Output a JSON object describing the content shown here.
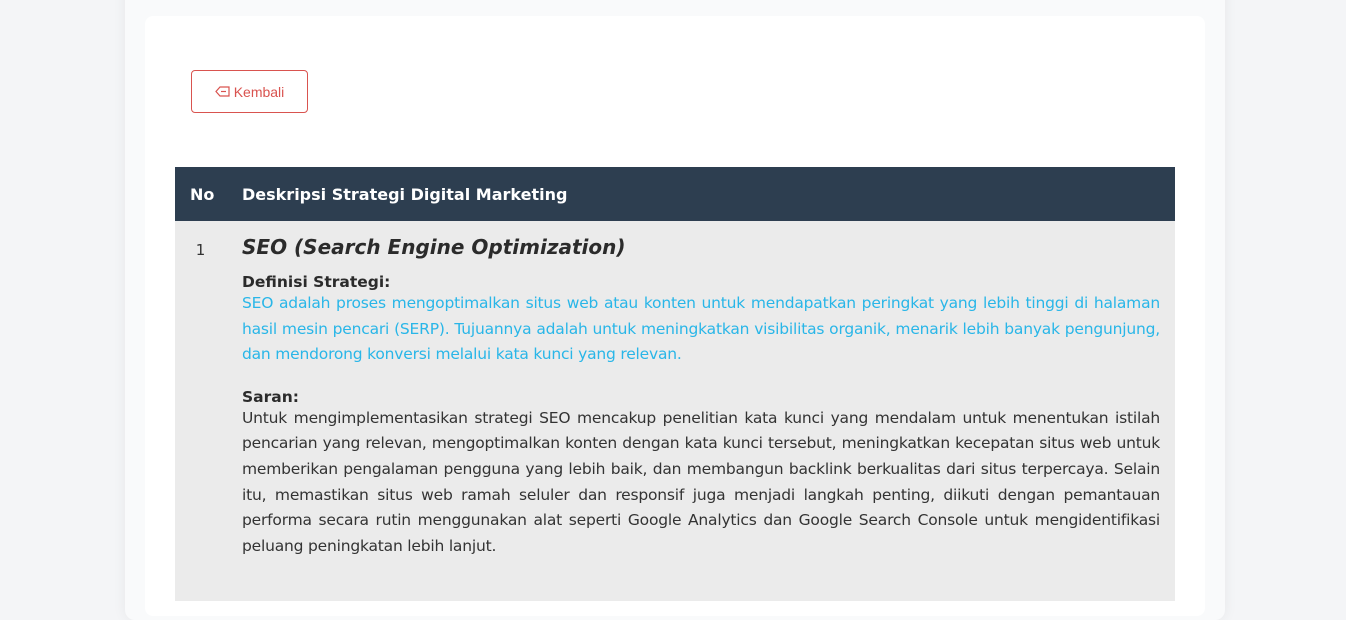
{
  "back_button": {
    "label": "Kembali",
    "icon": "back-arrow-icon"
  },
  "table": {
    "headers": {
      "no": "No",
      "description": "Deskripsi Strategi Digital Marketing"
    },
    "rows": [
      {
        "no": "1",
        "title": "SEO (Search Engine Optimization)",
        "definition_label": "Definisi Strategi:",
        "definition": "SEO adalah proses mengoptimalkan situs web atau konten untuk mendapatkan peringkat yang lebih tinggi di halaman hasil mesin pencari (SERP). Tujuannya adalah untuk meningkatkan visibilitas organik, menarik lebih banyak pengunjung, dan mendorong konversi melalui kata kunci yang relevan.",
        "suggestion_label": "Saran:",
        "suggestion": "Untuk mengimplementasikan strategi SEO mencakup penelitian kata kunci yang mendalam untuk menentukan istilah pencarian yang relevan, mengoptimalkan konten dengan kata kunci tersebut, meningkatkan kecepatan situs web untuk memberikan pengalaman pengguna yang lebih baik, dan membangun backlink berkualitas dari situs terpercaya. Selain itu, memastikan situs web ramah seluler dan responsif juga menjadi langkah penting, diikuti dengan pemantauan performa secara rutin menggunakan alat seperti Google Analytics dan Google Search Console untuk mengidentifikasi peluang peningkatan lebih lanjut."
      }
    ]
  },
  "colors": {
    "header_bg": "#2d3e50",
    "row_bg": "#ebebeb",
    "accent_red": "#d9534f",
    "definition_text": "#29b6e8"
  }
}
